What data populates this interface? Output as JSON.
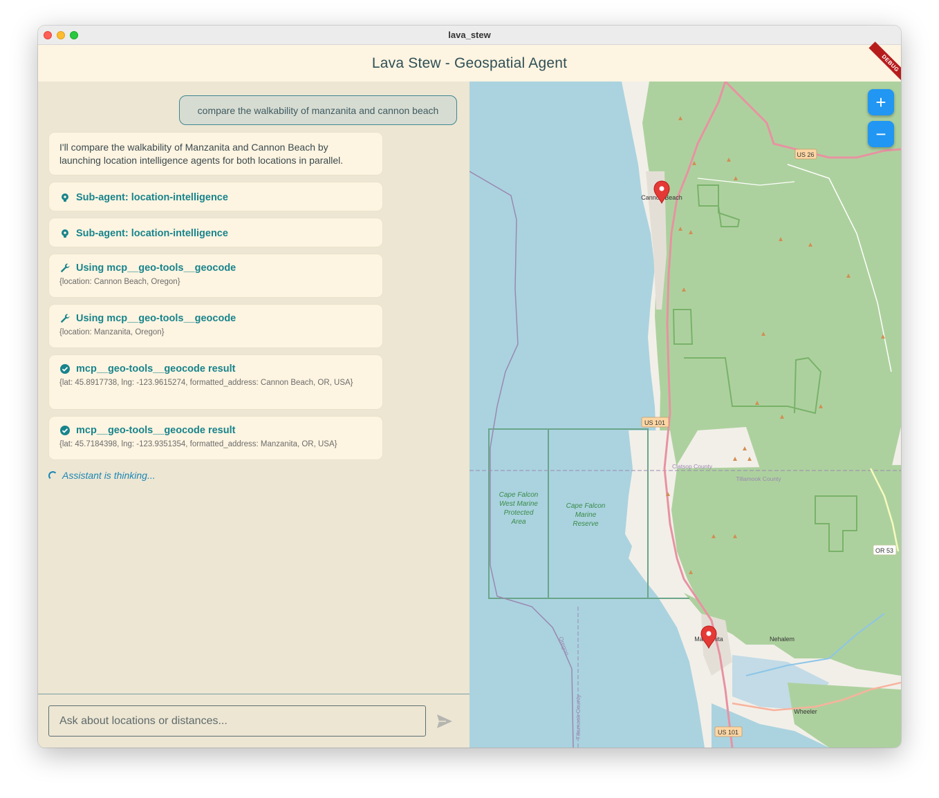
{
  "window": {
    "title": "lava_stew"
  },
  "appbar": {
    "title": "Lava Stew - Geospatial Agent",
    "debug_badge": "DEBUG"
  },
  "chat": {
    "user_message": "compare the walkability of manzanita and cannon beach",
    "assistant_message": "I'll compare the walkability of Manzanita and Cannon Beach by launching location intelligence agents for both locations in parallel.",
    "cards": [
      {
        "icon": "brain-icon",
        "title": "Sub-agent: location-intelligence",
        "detail": ""
      },
      {
        "icon": "brain-icon",
        "title": "Sub-agent: location-intelligence",
        "detail": ""
      },
      {
        "icon": "wrench-icon",
        "title": "Using mcp__geo-tools__geocode",
        "detail": "{location: Cannon Beach, Oregon}"
      },
      {
        "icon": "wrench-icon",
        "title": "Using mcp__geo-tools__geocode",
        "detail": "{location: Manzanita, Oregon}"
      },
      {
        "icon": "check-circle-icon",
        "title": "mcp__geo-tools__geocode result",
        "detail": "{lat: 45.8917738, lng: -123.9615274, formatted_address: Cannon Beach, OR, USA}"
      },
      {
        "icon": "check-circle-icon",
        "title": "mcp__geo-tools__geocode result",
        "detail": "{lat: 45.7184398, lng: -123.9351354, formatted_address: Manzanita, OR, USA}"
      }
    ],
    "thinking": "Assistant is thinking...",
    "input_placeholder": "Ask about locations or distances..."
  },
  "map": {
    "zoom_in": "+",
    "zoom_out": "−",
    "labels": {
      "us26": "US 26",
      "us101_north": "US 101",
      "us101_south": "US 101",
      "or53": "OR 53",
      "cannon_beach": "Cannon Beach",
      "manzanita": "Manzanita",
      "nehalem": "Nehalem",
      "wheeler": "Wheeler",
      "clatsop": "Clatsop County",
      "tillamook": "Tillamook County",
      "tillamook_vertical": "Tillamook County",
      "oregon": "Oregon",
      "cape_falcon_west": [
        "Cape Falcon",
        "West Marine",
        "Protected",
        "Area"
      ],
      "cape_falcon_reserve": [
        "Cape Falcon",
        "Marine",
        "Reserve"
      ]
    },
    "markers": [
      {
        "name": "Cannon Beach",
        "lat": 45.8917738,
        "lng": -123.9615274
      },
      {
        "name": "Manzanita",
        "lat": 45.7184398,
        "lng": -123.9351354
      }
    ]
  }
}
